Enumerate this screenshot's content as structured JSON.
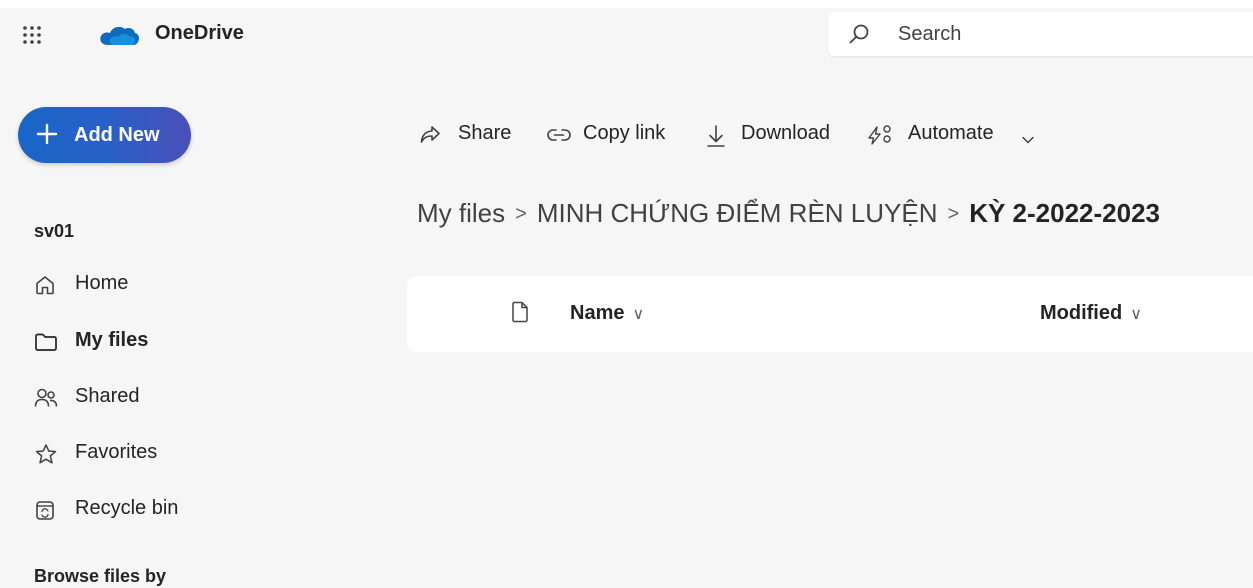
{
  "header": {
    "app_name": "OneDrive",
    "search_placeholder": "Search"
  },
  "sidebar": {
    "add_new_label": "Add New",
    "account_name": "sv01",
    "items": [
      {
        "label": "Home",
        "icon": "home-icon",
        "active": false
      },
      {
        "label": "My files",
        "icon": "folder-icon",
        "active": true
      },
      {
        "label": "Shared",
        "icon": "people-icon",
        "active": false
      },
      {
        "label": "Favorites",
        "icon": "star-icon",
        "active": false
      },
      {
        "label": "Recycle bin",
        "icon": "recycle-bin-icon",
        "active": false
      }
    ],
    "browse_heading": "Browse files by"
  },
  "toolbar": {
    "share_label": "Share",
    "copy_link_label": "Copy link",
    "download_label": "Download",
    "automate_label": "Automate"
  },
  "breadcrumb": {
    "root": "My files",
    "parent": "MINH CHỨNG ĐIỂM RÈN LUYỆN",
    "current": "KỲ 2-2022-2023",
    "separator": ">"
  },
  "file_list": {
    "columns": [
      {
        "label": "Name"
      },
      {
        "label": "Modified"
      }
    ],
    "rows": []
  },
  "colors": {
    "accent": "#1866c9",
    "accent_end": "#4b4fb8",
    "background": "#f6f6f6",
    "surface": "#ffffff"
  }
}
